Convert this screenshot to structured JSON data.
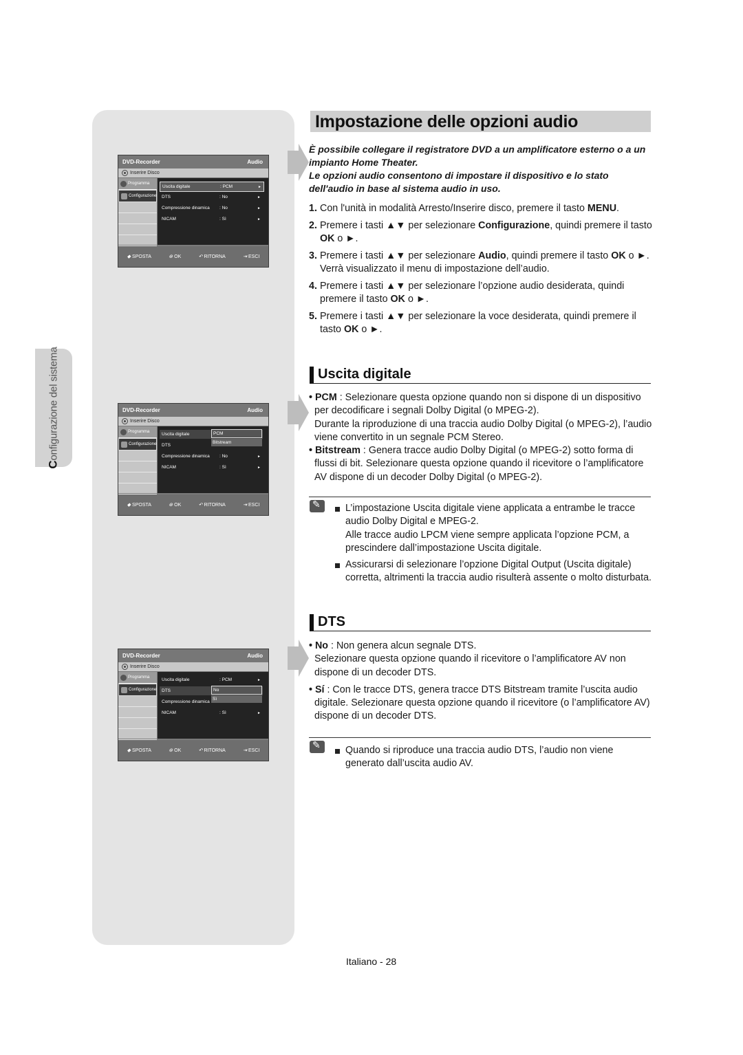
{
  "side_tab": {
    "first_letter": "C",
    "label_rest": "onfigurazione del sistema"
  },
  "title": "Impostazione delle opzioni audio",
  "intro": [
    "È possibile collegare il registratore DVD a un amplificatore esterno o a un impianto Home Theater.",
    "Le opzioni audio consentono di impostare il dispositivo e lo stato dell'audio in base al sistema audio in uso."
  ],
  "steps": [
    {
      "num": "1.",
      "pre": "Con l'unità in modalità Arresto/Inserire disco, premere il tasto ",
      "bold": "MENU",
      "post": "."
    },
    {
      "num": "2.",
      "pre": "Premere i tasti ▲▼ per selezionare ",
      "bold": "Configurazione",
      "post": ", quindi premere il tasto ",
      "bold2": "OK",
      "post2": " o ►."
    },
    {
      "num": "3.",
      "pre": "Premere i tasti ▲▼ per selezionare ",
      "bold": "Audio",
      "post": ", quindi premere il tasto ",
      "bold2": "OK",
      "post2": " o ►. Verrà visualizzato il menu di impostazione dell’audio."
    },
    {
      "num": "4.",
      "pre": "Premere i tasti ▲▼ per selezionare l’opzione audio desiderata, quindi premere il tasto ",
      "bold": "OK",
      "post": " o ►."
    },
    {
      "num": "5.",
      "pre": "Premere i tasti ▲▼ per selezionare la voce desiderata, quindi premere il tasto ",
      "bold": "OK",
      "post": " o ►."
    }
  ],
  "uscita": {
    "heading": "Uscita digitale",
    "bullets": [
      {
        "term": "PCM",
        "text": " : Selezionare questa opzione quando non si dispone di un dispositivo per decodificare i segnali Dolby Digital (o MPEG-2).",
        "extra": "Durante la riproduzione di una traccia audio Dolby Digital (o MPEG-2), l’audio viene convertito in un segnale PCM Stereo."
      },
      {
        "term": "Bitstream",
        "text": " : Genera tracce audio Dolby Digital (o MPEG-2) sotto forma di flussi di bit. Selezionare questa opzione quando il ricevitore o l’amplificatore AV dispone di un decoder Dolby Digital (o MPEG-2).",
        "extra": ""
      }
    ],
    "notes": [
      {
        "text": "L’impostazione Uscita digitale viene applicata a entrambe le tracce audio Dolby Digital e MPEG-2.",
        "extra": "Alle tracce audio LPCM viene sempre applicata l’opzione PCM, a prescindere dall’impostazione Uscita digitale."
      },
      {
        "text": "Assicurarsi di selezionare l’opzione Digital Output (Uscita digitale) corretta, altrimenti la traccia audio risulterà assente o molto disturbata.",
        "extra": ""
      }
    ]
  },
  "dts": {
    "heading": "DTS",
    "bullets": [
      {
        "term": "No",
        "text": " : Non genera alcun segnale DTS.",
        "extra": "Selezionare questa opzione quando il ricevitore o l’amplificatore AV non dispone di un decoder DTS."
      },
      {
        "term": "Sí",
        "text": " : Con le tracce DTS, genera tracce DTS Bitstream tramite l’uscita audio digitale. Selezionare questa opzione quando il ricevitore (o l’amplificatore AV) dispone di un decoder DTS.",
        "extra": ""
      }
    ],
    "notes": [
      {
        "text": "Quando si riproduce una traccia audio DTS, l’audio non viene generato dall’uscita audio AV.",
        "extra": ""
      }
    ]
  },
  "osd": {
    "brand": "DVD-Recorder",
    "section": "Audio",
    "disc_status": "Inserire Disco",
    "side": [
      "Programma",
      "Configurazione"
    ],
    "rows": [
      {
        "label": "Uscita digitale",
        "value": ": PCM"
      },
      {
        "label": "DTS",
        "value": ": No"
      },
      {
        "label": "Compressione dinamica",
        "value": ": No"
      },
      {
        "label": "NICAM",
        "value": ": Sì"
      }
    ],
    "popup_uscita": [
      "PCM",
      "Bitstream"
    ],
    "popup_dts": [
      "No",
      "Sì"
    ],
    "footer": {
      "move": "SPOSTA",
      "ok": "OK",
      "back": "RITORNA",
      "exit": "ESCI"
    }
  },
  "page_number": "Italiano - 28"
}
